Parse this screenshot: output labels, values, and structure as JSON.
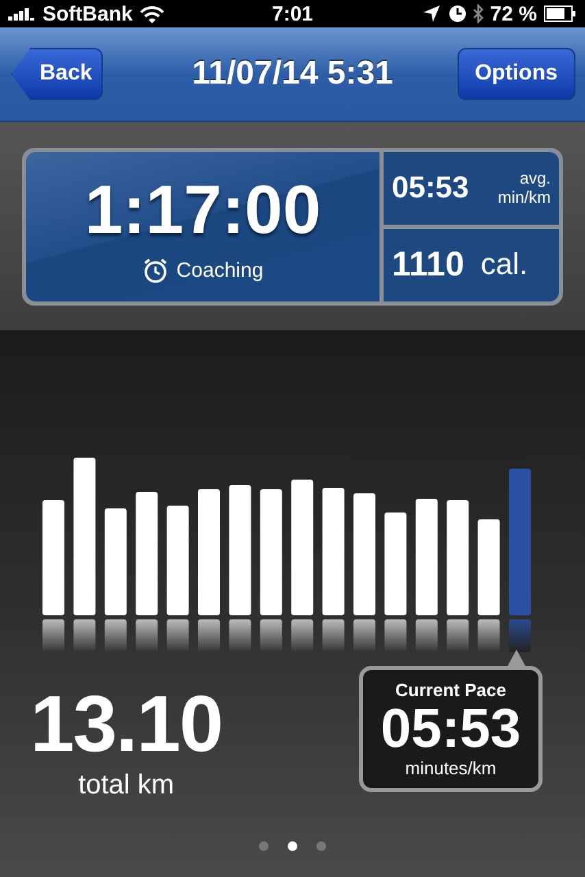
{
  "status_bar": {
    "carrier": "SoftBank",
    "time": "7:01",
    "battery": "72 %"
  },
  "nav_bar": {
    "back": "Back",
    "title": "11/07/14 5:31",
    "options": "Options"
  },
  "summary": {
    "duration": "1:17:00",
    "coaching": "Coaching",
    "avg_pace": "05:53",
    "avg_unit_top": "avg.",
    "avg_unit_bottom": "min/km",
    "calories": "1110",
    "calories_unit": "cal."
  },
  "distance": {
    "value": "13.10",
    "label": "total km"
  },
  "current_pace": {
    "title": "Current Pace",
    "value": "05:53",
    "unit": "minutes/km"
  },
  "pages": [
    {
      "selected": false
    },
    {
      "selected": true
    },
    {
      "selected": false
    }
  ]
}
